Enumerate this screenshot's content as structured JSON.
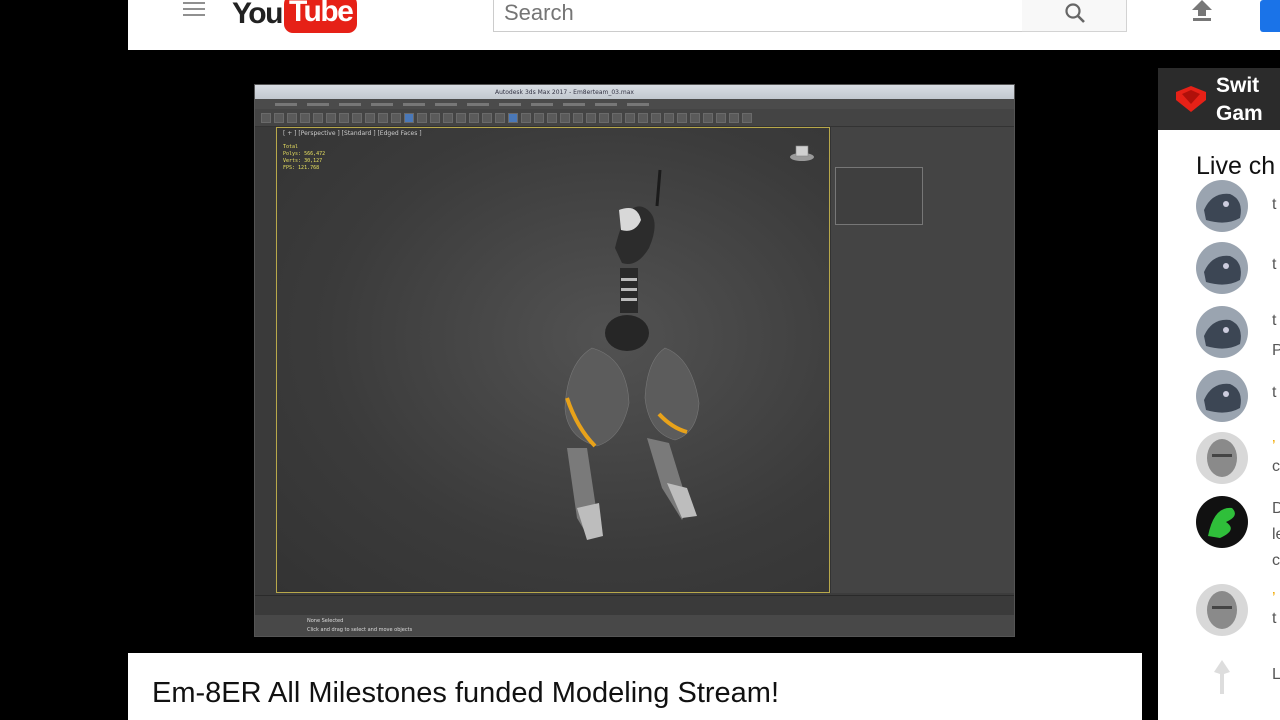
{
  "header": {
    "logo_you": "You",
    "logo_tube": "Tube",
    "search_placeholder": "Search",
    "icons": [
      "menu-icon",
      "search-icon",
      "upload-icon"
    ]
  },
  "player": {
    "app_title": "Autodesk 3ds Max 2017 - Em8erteam_03.max",
    "viewport_label": "[ + ] [Perspective ] [Standard ] [Edged Faces ]",
    "stats": [
      "Total",
      "Polys: 566,472",
      "Verts: 30,127",
      "FPS: 121.768"
    ],
    "status_text": "None Selected",
    "status_hint": "Click and drag to select and move objects"
  },
  "chat": {
    "channel": "Switch Gaming",
    "channel_line1": "Swit",
    "channel_line2": "Gam",
    "title": "Live ch",
    "messages": [
      {
        "avatar": "robot-wolf",
        "lines": [
          "t"
        ]
      },
      {
        "avatar": "robot-wolf",
        "lines": [
          "t"
        ]
      },
      {
        "avatar": "robot-wolf",
        "lines": [
          "t",
          "P"
        ]
      },
      {
        "avatar": "robot-wolf",
        "lines": [
          "t"
        ]
      },
      {
        "avatar": "bald-head",
        "badge": "’",
        "lines": [
          "c"
        ]
      },
      {
        "avatar": "green-dragon",
        "lines": [
          "D",
          "le",
          "c"
        ]
      },
      {
        "avatar": "bald-head",
        "badge": "’",
        "lines": [
          "t"
        ]
      },
      {
        "avatar": "white-emblem",
        "lines": [
          "L"
        ]
      }
    ]
  },
  "video": {
    "title": "Em-8ER All Milestones funded Modeling Stream!"
  },
  "colors": {
    "youtube_red": "#e62117",
    "viewport_border": "#b8a84a",
    "model_accent": "#e8a21a"
  }
}
